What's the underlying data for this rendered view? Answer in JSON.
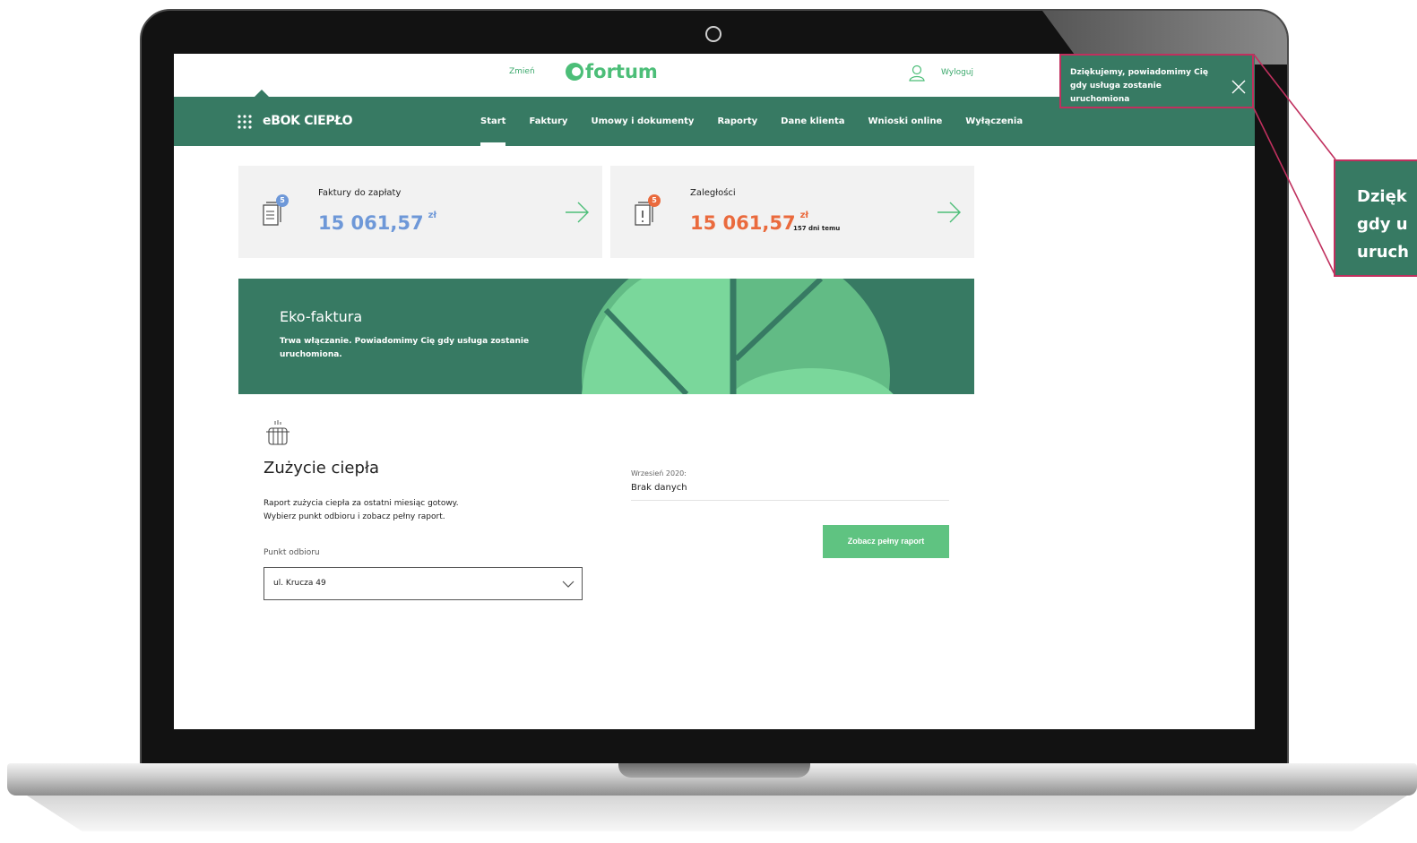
{
  "header": {
    "change_label": "Zmień",
    "logo_text": "fortum",
    "logout_label": "Wyloguj"
  },
  "nav": {
    "brand": "eBOK CIEPŁO",
    "links": [
      "Start",
      "Faktury",
      "Umowy i dokumenty",
      "Raporty",
      "Dane klienta",
      "Wnioski online",
      "Wyłączenia"
    ],
    "active": "Start"
  },
  "toast": {
    "message": "Dziękujemy, powiadomimy Cię gdy usługa zostanie uruchomiona"
  },
  "cards": [
    {
      "title": "Faktury do zapłaty",
      "badge": "5",
      "amount": "15 061,57",
      "currency": "zł",
      "color": "#6e98d8"
    },
    {
      "title": "Zaległości",
      "badge": "5",
      "amount": "15 061,57",
      "currency": "zł",
      "days": "157 dni temu",
      "color": "#ea6a3d"
    }
  ],
  "banner": {
    "title": "Eko-faktura",
    "text": "Trwa włączanie. Powiadomimy Cię gdy usługa zostanie uruchomiona."
  },
  "heat": {
    "title": "Zużycie ciepła",
    "description_line1": "Raport zużycia ciepła za ostatni miesiąc gotowy.",
    "description_line2": "Wybierz punkt odbioru i zobacz pełny raport.",
    "point_label": "Punkt odbioru",
    "point_value": "ul. Krucza 49",
    "period_label": "Wrzesień 2020:",
    "period_value": "Brak danych",
    "report_button": "Zobacz pełny raport"
  },
  "zoom_callout": {
    "lines": [
      "Dzięk",
      "gdy u",
      "uruch"
    ]
  },
  "colors": {
    "nav_green": "#377a63",
    "brand_green": "#4cbe78",
    "button_green": "#5fc381",
    "invoice_blue": "#6e98d8",
    "overdue_orange": "#ea6a3d",
    "highlight": "#c0305e"
  },
  "icons": [
    "grid-icon",
    "user-icon",
    "close-icon",
    "invoice-icon",
    "warning-document-icon",
    "arrow-right-icon",
    "radiator-icon",
    "chevron-down-icon"
  ]
}
